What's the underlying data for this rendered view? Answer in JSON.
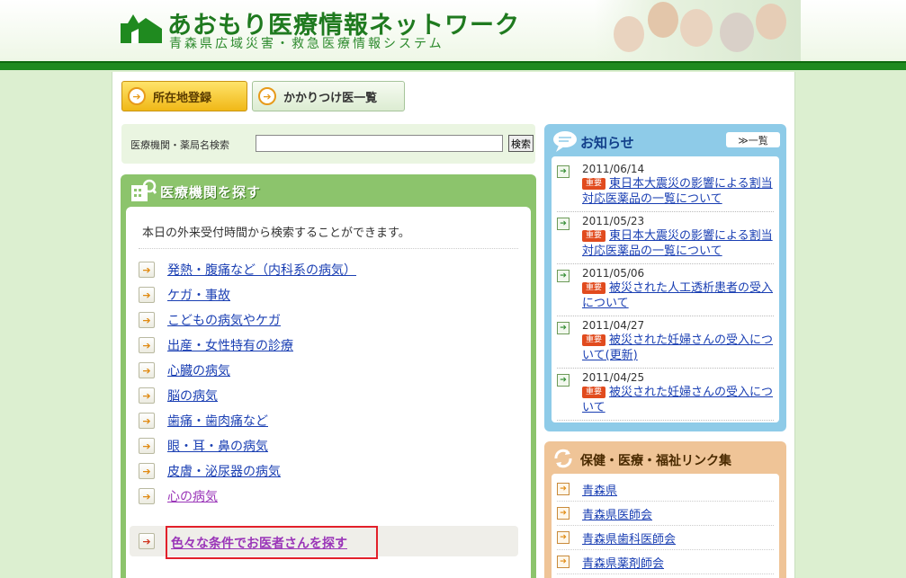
{
  "header": {
    "title": "あおもり医療情報ネットワーク",
    "subtitle": "青森県広域災害・救急医療情報システム"
  },
  "top_buttons": {
    "register_label": "所在地登録",
    "doctors_label": "かかりつけ医一覧"
  },
  "search": {
    "label": "医療機関・薬局名検索",
    "value": "",
    "button_label": "検索"
  },
  "find": {
    "title": "医療機関を探す",
    "intro": "本日の外来受付時間から検索することができます。",
    "categories": [
      {
        "label": "発熱・腹痛など（内科系の病気）",
        "visited": false
      },
      {
        "label": "ケガ・事故",
        "visited": false
      },
      {
        "label": "こどもの病気やケガ",
        "visited": false
      },
      {
        "label": "出産・女性特有の診療",
        "visited": false
      },
      {
        "label": "心臓の病気",
        "visited": false
      },
      {
        "label": "脳の病気",
        "visited": false
      },
      {
        "label": "歯痛・歯肉痛など",
        "visited": false
      },
      {
        "label": "眼・耳・鼻の病気",
        "visited": false
      },
      {
        "label": "皮膚・泌尿器の病気",
        "visited": false
      },
      {
        "label": "心の病気",
        "visited": true
      }
    ],
    "condition_link": "色々な条件でお医者さんを探す"
  },
  "news": {
    "title": "お知らせ",
    "more_label": "≫一覧",
    "badge": "重要",
    "items": [
      {
        "date": "2011/06/14",
        "text": "東日本大震災の影響による割当対応医薬品の一覧について"
      },
      {
        "date": "2011/05/23",
        "text": "東日本大震災の影響による割当対応医薬品の一覧について"
      },
      {
        "date": "2011/05/06",
        "text": "被災された人工透析患者の受入について"
      },
      {
        "date": "2011/04/27",
        "text": "被災された妊婦さんの受入について(更新)"
      },
      {
        "date": "2011/04/25",
        "text": "被災された妊婦さんの受入について"
      }
    ]
  },
  "links": {
    "title": "保健・医療・福祉リンク集",
    "items": [
      "青森県",
      "青森県医師会",
      "青森県歯科医師会",
      "青森県薬剤師会"
    ]
  },
  "colors": {
    "brand_green": "#1f8a1f",
    "news_blue": "#8ecbe8",
    "links_orange": "#efc497",
    "badge_red": "#e14b1e"
  }
}
